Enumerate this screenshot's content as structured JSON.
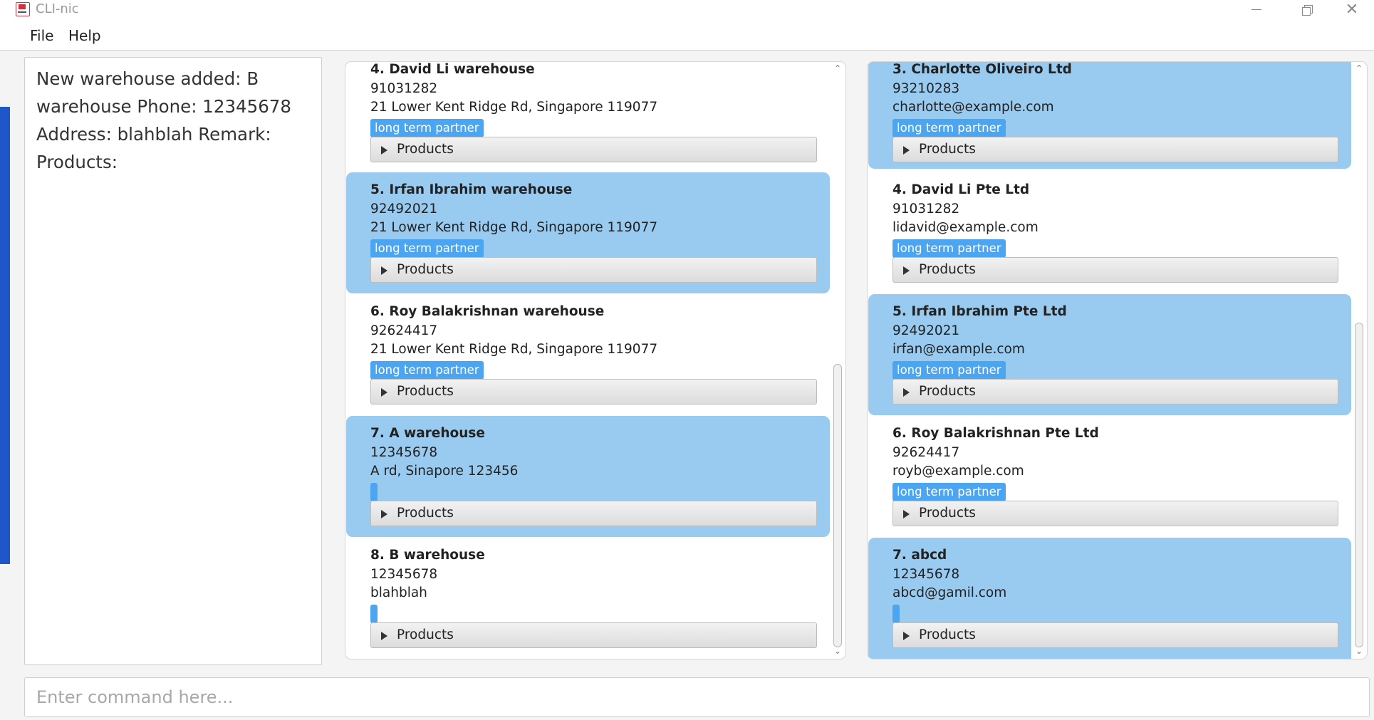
{
  "window": {
    "title": "CLI-nic",
    "app_icon": "clinic-app-icon",
    "controls": [
      "minimize-icon",
      "maximize-icon",
      "close-icon"
    ]
  },
  "menu": {
    "file": "File",
    "help": "Help"
  },
  "result_display": {
    "lines": [
      "New warehouse added: B",
      "warehouse Phone: 12345678",
      "Address: blahblah Remark:",
      "Products:"
    ]
  },
  "warehouse_list": {
    "cards": [
      {
        "title": "4.  David Li warehouse",
        "phone": "91031282",
        "line": "21 Lower Kent Ridge Rd, Singapore 119077",
        "tag": "long term partner",
        "products": "Products",
        "selected": false
      },
      {
        "title": "5.  Irfan Ibrahim warehouse",
        "phone": "92492021",
        "line": "21 Lower Kent Ridge Rd, Singapore 119077",
        "tag": "long term partner",
        "products": "Products",
        "selected": true
      },
      {
        "title": "6.  Roy Balakrishnan warehouse",
        "phone": "92624417",
        "line": "21 Lower Kent Ridge Rd, Singapore 119077",
        "tag": "long term partner",
        "products": "Products",
        "selected": false
      },
      {
        "title": "7.  A warehouse",
        "phone": "12345678",
        "line": "A rd, Sinapore 123456",
        "tag": "",
        "products": "Products",
        "selected": true
      },
      {
        "title": "8.  B warehouse",
        "phone": "12345678",
        "line": "blahblah",
        "tag": "",
        "products": "Products",
        "selected": false
      }
    ]
  },
  "supplier_list": {
    "cards": [
      {
        "title": "3.  Charlotte Oliveiro Ltd",
        "phone": "93210283",
        "line": "charlotte@example.com",
        "tag": "long term partner",
        "products": "Products",
        "selected": true
      },
      {
        "title": "4.  David Li Pte Ltd",
        "phone": "91031282",
        "line": "lidavid@example.com",
        "tag": "long term partner",
        "products": "Products",
        "selected": false
      },
      {
        "title": "5.  Irfan Ibrahim Pte Ltd",
        "phone": "92492021",
        "line": "irfan@example.com",
        "tag": "long term partner",
        "products": "Products",
        "selected": true
      },
      {
        "title": "6.  Roy Balakrishnan Pte Ltd",
        "phone": "92624417",
        "line": "royb@example.com",
        "tag": "long term partner",
        "products": "Products",
        "selected": false
      },
      {
        "title": "7.  abcd",
        "phone": "12345678",
        "line": "abcd@gamil.com",
        "tag": "",
        "products": "Products",
        "selected": true
      }
    ]
  },
  "command": {
    "placeholder": "Enter command here...",
    "value": ""
  },
  "colors": {
    "selected_card": "#99cbf1",
    "tag": "#4ba5f0",
    "taskbar": "#1f56c9"
  }
}
